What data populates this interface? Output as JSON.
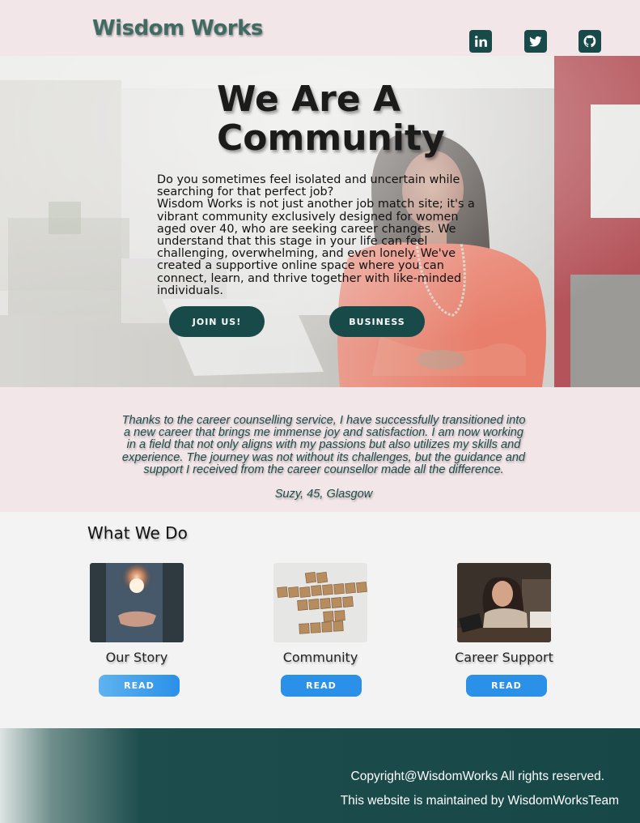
{
  "header": {
    "logo": "Wisdom Works",
    "social": [
      {
        "name": "linkedin-icon"
      },
      {
        "name": "twitter-icon"
      },
      {
        "name": "github-icon"
      }
    ]
  },
  "hero": {
    "title": "We Are A Community",
    "intro_question": "Do you sometimes feel isolated and uncertain while searching for that perfect job?",
    "intro_body": "Wisdom Works is not just another job match site; it's a vibrant community exclusively designed for women aged over 40, who are seeking career changes. We understand that this stage in your life can feel challenging, overwhelming, and even lonely. We've created a supportive online space where you can connect, learn, and thrive together with like-minded individuals.",
    "join_label": "JOIN US!",
    "business_label": "BUSINESS"
  },
  "testimonial": {
    "quote": "Thanks to the career counselling service, I have successfully transitioned into a new career that brings me immense joy and satisfaction. I am now working in a field that not only aligns with my passions but also utilizes my skills and experience. The journey was not without its challenges, but the guidance and support I received from the career counsellor made all the difference.",
    "author": "Suzy, 45, Glasgow"
  },
  "what_we_do": {
    "title": "What We Do",
    "cards": [
      {
        "title": "Our Story",
        "button": "READ"
      },
      {
        "title": "Community",
        "button": "READ"
      },
      {
        "title": "Career Support",
        "button": "READ"
      }
    ]
  },
  "footer": {
    "copyright": "Copyright@WisdomWorks All rights reserved.",
    "maintained": "This website is maintained by WisdomWorksTeam"
  },
  "colors": {
    "brand_dark": "#194a4a",
    "header_bg": "#f3e6e8",
    "button_blue": "#2a90e8"
  }
}
